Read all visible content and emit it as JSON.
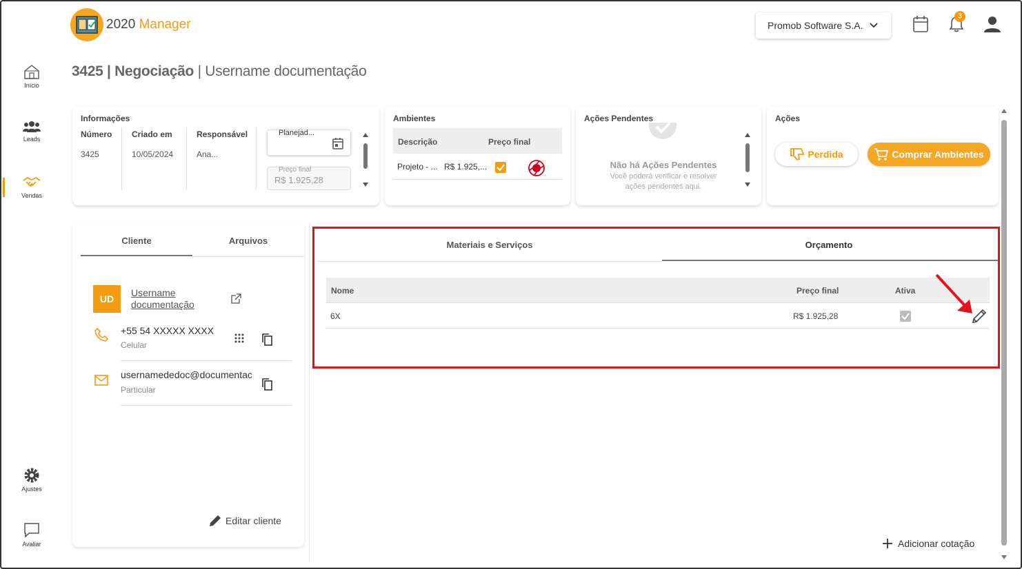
{
  "app": {
    "logo_num": "2020",
    "logo_name": "Manager"
  },
  "header": {
    "company": "Promob Software S.A.",
    "notifications_count": "3"
  },
  "sidebar": {
    "items": [
      {
        "label": "Início",
        "icon": "home-icon"
      },
      {
        "label": "Leads",
        "icon": "users-icon"
      },
      {
        "label": "Vendas",
        "icon": "handshake-icon"
      },
      {
        "label": "Ajustes",
        "icon": "gear-icon"
      },
      {
        "label": "Avaliar",
        "icon": "chat-icon"
      }
    ],
    "active": "Vendas"
  },
  "page": {
    "title_bold": "3425 | Negociação",
    "title_sep": " | ",
    "title_rest": "Username documentação"
  },
  "informacoes": {
    "title": "Informações",
    "cols": [
      {
        "header": "Número",
        "value": "3425"
      },
      {
        "header": "Criado em",
        "value": "10/05/2024"
      },
      {
        "header": "Responsável",
        "value": "Ana..."
      }
    ],
    "status_value": "Planejad...",
    "preco_label": "Preço final",
    "preco_value": "R$ 1.925,28"
  },
  "ambientes": {
    "title": "Ambientes",
    "headers": [
      "Descrição",
      "Preço final"
    ],
    "rows": [
      {
        "descricao": "Projeto - ...",
        "preco": "R$ 1.925,..."
      }
    ]
  },
  "acoes_pendentes": {
    "title": "Ações Pendentes",
    "empty_title": "Não há Ações Pendentes",
    "empty_line1": "Você poderá verificar e resolver",
    "empty_line2": "ações pendentes aqui."
  },
  "acoes": {
    "title": "Ações",
    "perdida": "Perdida",
    "comprar": "Comprar Ambientes"
  },
  "client": {
    "tabs": [
      "Cliente",
      "Arquivos"
    ],
    "initials": "UD",
    "name_line1": "Username",
    "name_line2": "documentação",
    "phone": "+55 54 XXXXX XXXX",
    "phone_type": "Celular",
    "email": "usernamededoc@documentac",
    "email_type": "Particular",
    "edit": "Editar cliente"
  },
  "main": {
    "tabs": [
      "Materiais e Serviços",
      "Orçamento"
    ],
    "active_tab": "Orçamento",
    "table": {
      "headers": {
        "nome": "Nome",
        "preco": "Preço final",
        "ativa": "Ativa"
      },
      "rows": [
        {
          "nome": "6X",
          "preco": "R$ 1.925,28",
          "ativa": true
        }
      ]
    },
    "add_quote": "Adicionar cotação"
  },
  "colors": {
    "accent": "#f39c12",
    "highlight": "#e3131b",
    "arrow": "#e3131b"
  }
}
